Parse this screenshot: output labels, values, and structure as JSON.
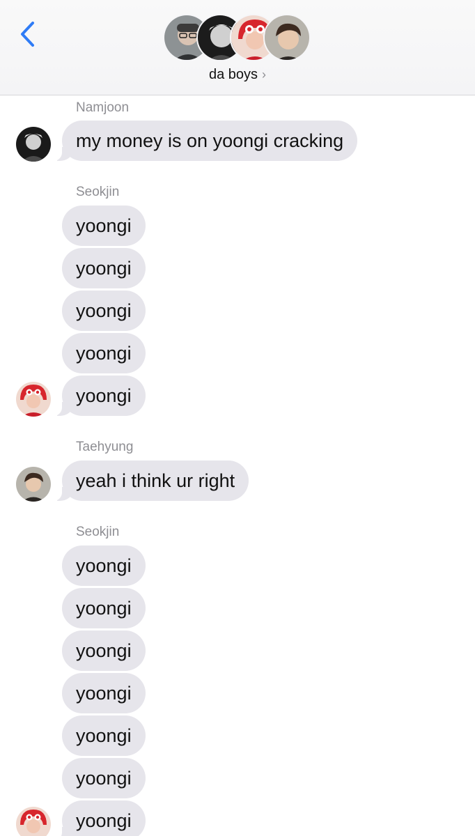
{
  "header": {
    "back_icon": "chevron-left-icon",
    "title": "da boys",
    "title_chevron": "›",
    "accent_color": "#2f7cf6",
    "participants": [
      "participant-1",
      "participant-2",
      "participant-3",
      "participant-4"
    ]
  },
  "messages": [
    {
      "sender": "Namjoon",
      "text": "my money is on yoongi cracking"
    },
    {
      "sender": "Seokjin",
      "text": "yoongi"
    },
    {
      "text": "yoongi"
    },
    {
      "text": "yoongi"
    },
    {
      "text": "yoongi"
    },
    {
      "text": "yoongi"
    },
    {
      "sender": "Taehyung",
      "text": "yeah i think ur right"
    },
    {
      "sender": "Seokjin",
      "text": "yoongi"
    },
    {
      "text": "yoongi"
    },
    {
      "text": "yoongi"
    },
    {
      "text": "yoongi"
    },
    {
      "text": "yoongi"
    },
    {
      "text": "yoongi"
    },
    {
      "text": "yoongi"
    }
  ],
  "colors": {
    "bubble": "#e6e5eb",
    "sender_label": "#8e8e93"
  }
}
